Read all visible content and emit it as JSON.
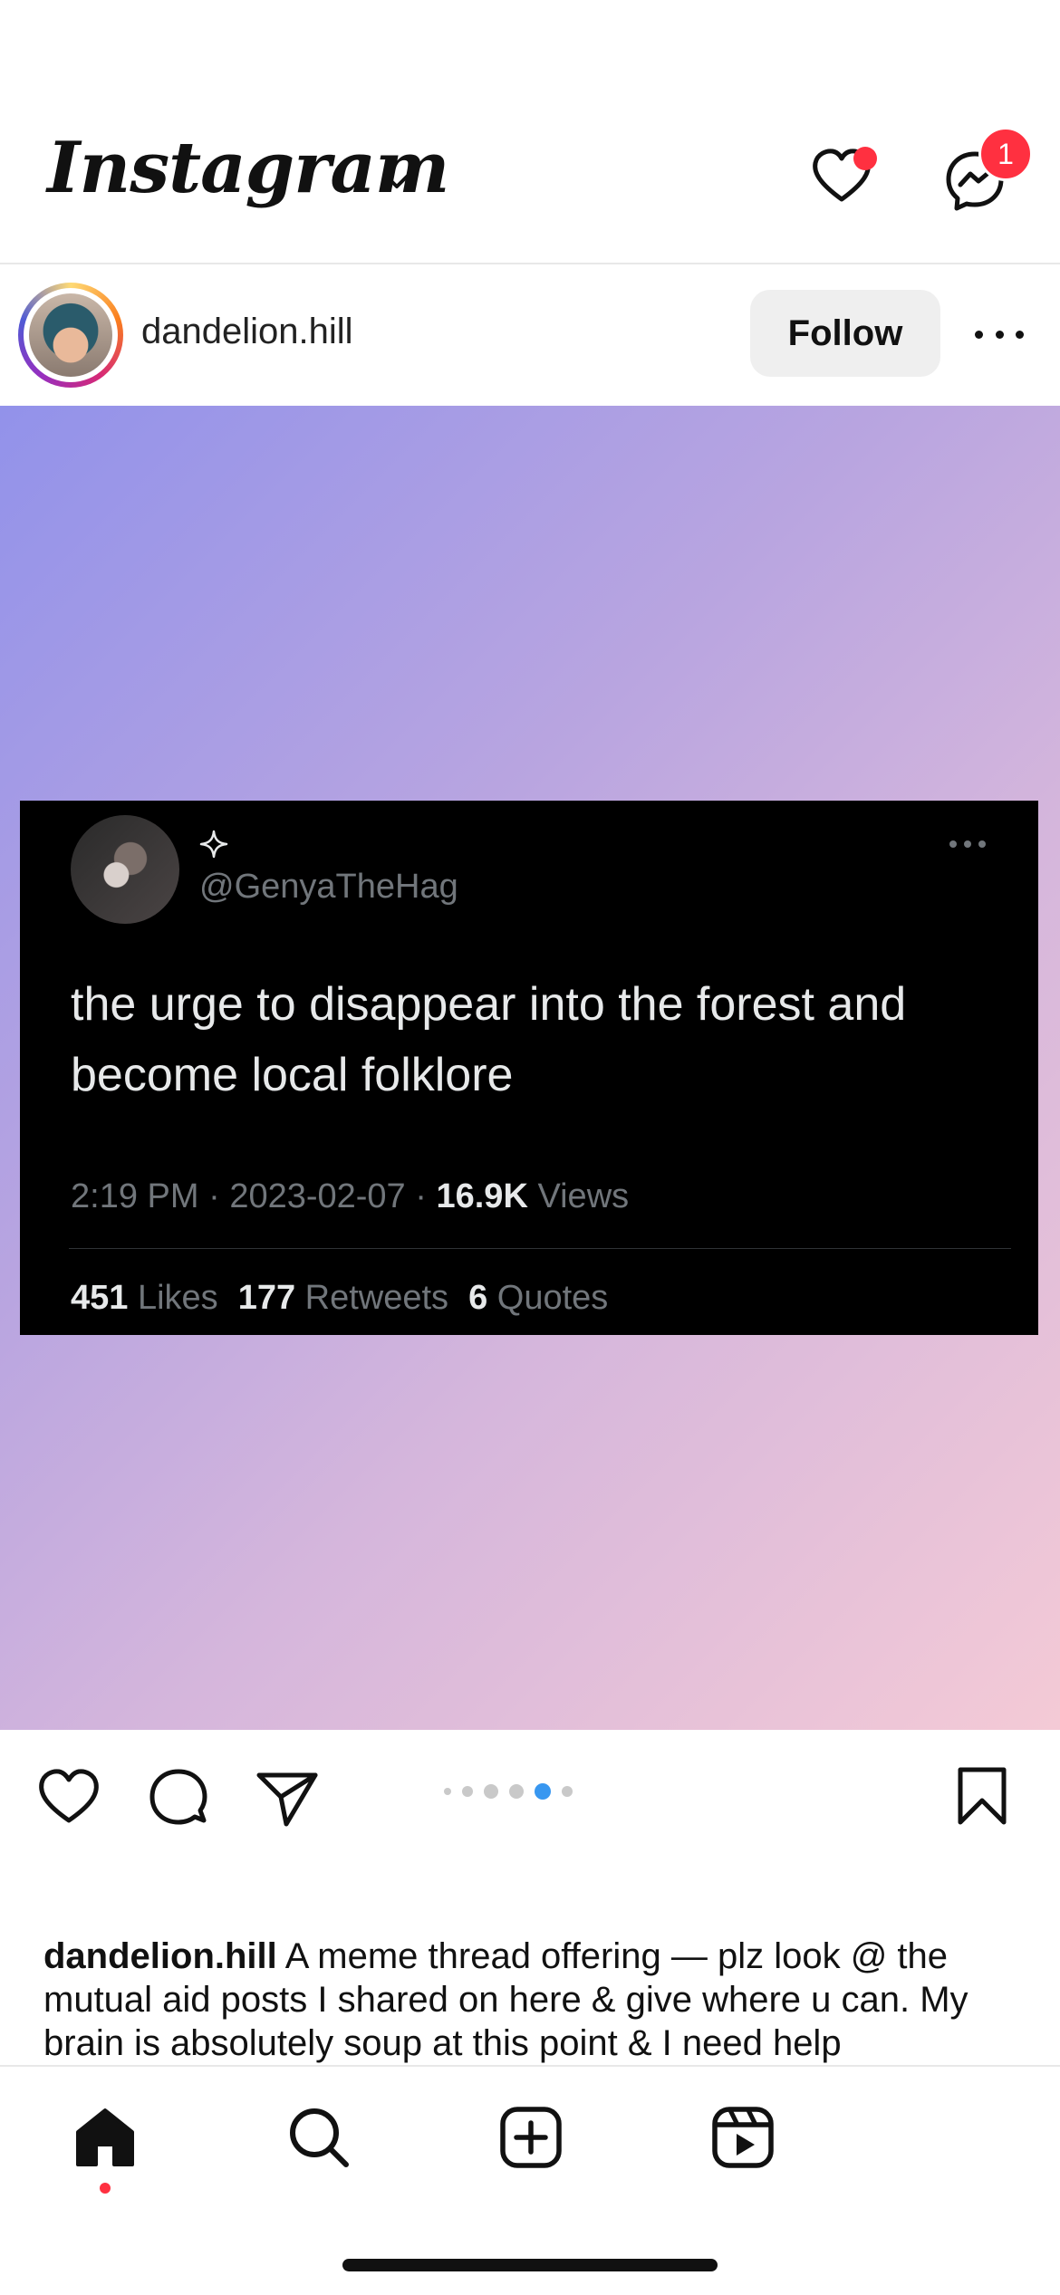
{
  "header": {
    "app_title": "Instagram",
    "notification_badge_count": "1"
  },
  "post": {
    "username": "dandelion.hill",
    "follow_label": "Follow",
    "carousel": {
      "count": 6,
      "active_index": 4
    },
    "caption_username": "dandelion.hill",
    "caption_text": "A meme thread offering — plz look @ the mutual aid posts I shared on here & give where u can. My brain is absolutely soup at this point & I need help"
  },
  "tweet": {
    "handle": "@GenyaTheHag",
    "text": "the urge to disappear into the forest and become local folklore",
    "time": "2:19 PM",
    "date": "2023-02-07",
    "views_count": "16.9K",
    "views_label": "Views",
    "likes_count": "451",
    "likes_label": "Likes",
    "retweets_count": "177",
    "retweets_label": "Retweets",
    "quotes_count": "6",
    "quotes_label": "Quotes"
  },
  "icons": {
    "header": [
      "chevron-down-icon",
      "heart-icon",
      "messenger-icon"
    ],
    "actions": [
      "like-icon",
      "comment-icon",
      "share-icon",
      "bookmark-icon"
    ],
    "nav": [
      "home-icon",
      "search-icon",
      "create-icon",
      "reels-icon"
    ]
  },
  "colors": {
    "notification_red": "#ff3040",
    "carousel_active": "#3897f0",
    "tweet_bg": "#000000",
    "tweet_muted": "#71767b"
  }
}
